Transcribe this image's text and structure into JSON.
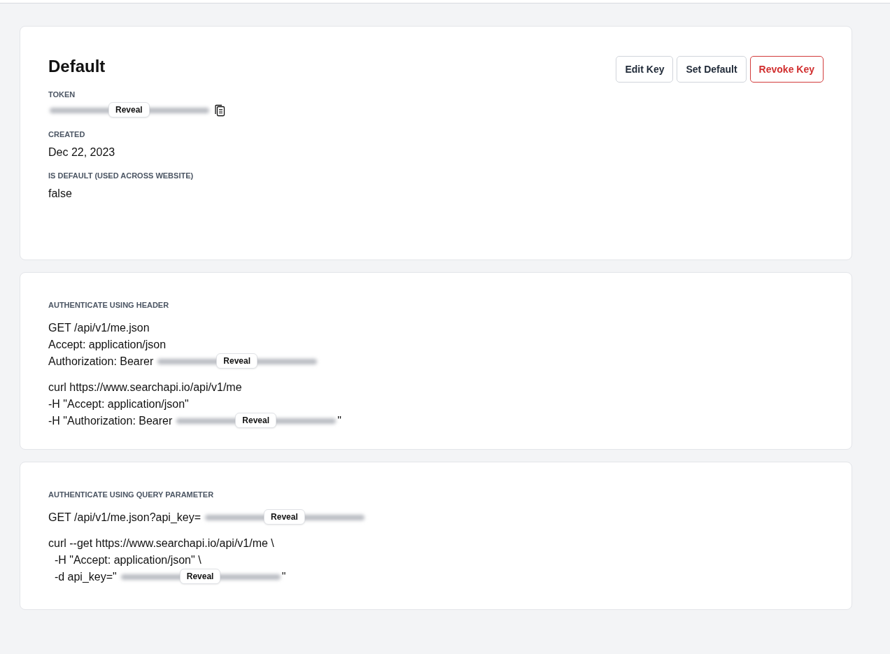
{
  "key_card": {
    "title": "Default",
    "buttons": [
      {
        "label": "Edit Key",
        "kind": "plain"
      },
      {
        "label": "Set Default",
        "kind": "plain"
      },
      {
        "label": "Revoke Key",
        "kind": "danger"
      }
    ],
    "token": {
      "label": "TOKEN",
      "reveal": "Reveal"
    },
    "fields": [
      {
        "label": "CREATED",
        "value": "Dec 22, 2023"
      },
      {
        "label": "IS DEFAULT (USED ACROSS WEBSITE)",
        "value": "false"
      }
    ]
  },
  "sections": [
    {
      "heading": "AUTHENTICATE USING HEADER",
      "blocks": [
        [
          [
            {
              "kind": "text",
              "text": "GET /api/v1/me.json"
            }
          ],
          [
            {
              "kind": "text",
              "text": "Accept: application/json"
            }
          ],
          [
            {
              "kind": "text",
              "text": "Authorization: Bearer"
            },
            {
              "kind": "secret",
              "reveal": "Reveal"
            }
          ]
        ],
        [
          [
            {
              "kind": "text",
              "text": "curl https://www.searchapi.io/api/v1/me"
            }
          ],
          [
            {
              "kind": "text",
              "text": "-H \"Accept: application/json\""
            }
          ],
          [
            {
              "kind": "text",
              "text": "-H \"Authorization: Bearer"
            },
            {
              "kind": "secret",
              "reveal": "Reveal"
            },
            {
              "kind": "text",
              "text": "\""
            }
          ]
        ]
      ]
    },
    {
      "heading": "AUTHENTICATE USING QUERY PARAMETER",
      "blocks": [
        [
          [
            {
              "kind": "text",
              "text": "GET /api/v1/me.json?api_key="
            },
            {
              "kind": "secret",
              "reveal": "Reveal"
            }
          ]
        ],
        [
          [
            {
              "kind": "text",
              "text": "curl --get https://www.searchapi.io/api/v1/me \\"
            }
          ],
          [
            {
              "kind": "text",
              "text": "  -H \"Accept: application/json\" \\"
            }
          ],
          [
            {
              "kind": "text",
              "text": "  -d api_key=\""
            },
            {
              "kind": "secret",
              "reveal": "Reveal"
            },
            {
              "kind": "text",
              "text": "\""
            }
          ]
        ]
      ]
    }
  ]
}
